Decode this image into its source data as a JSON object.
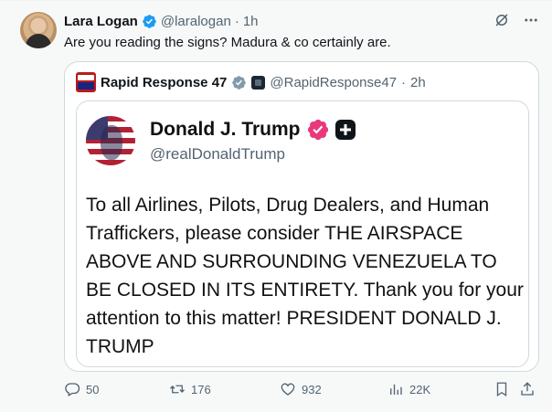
{
  "tweet": {
    "author_name": "Lara Logan",
    "author_handle": "@laralogan",
    "separator": "·",
    "time": "1h",
    "text": "Are you reading the signs? Madura & co certainly are."
  },
  "quote": {
    "author_name": "Rapid Response 47",
    "author_handle": "@RapidResponse47",
    "separator": "·",
    "time": "2h"
  },
  "truth_post": {
    "author_name": "Donald J. Trump",
    "author_handle": "@realDonaldTrump",
    "text": "To all Airlines, Pilots, Drug Dealers, and Human Traffickers, please consider THE AIRSPACE ABOVE AND SURROUNDING VENEZUELA TO BE CLOSED IN ITS ENTIRETY. Thank you for your attention to this matter! PRESIDENT DONALD J. TRUMP"
  },
  "actions": {
    "replies": "50",
    "reposts": "176",
    "likes": "932",
    "views": "22K"
  },
  "icons": [
    "verified-badge-icon",
    "grok-icon",
    "more-icon",
    "gray-verified-badge-icon",
    "affiliate-badge-icon",
    "pink-verified-badge-icon",
    "truth-plus-icon",
    "reply-icon",
    "repost-icon",
    "like-icon",
    "views-icon",
    "bookmark-icon",
    "share-icon"
  ],
  "colors": {
    "x_blue": "#1d9bf0",
    "muted_text": "#536471",
    "border": "#cfd9de",
    "truth_pink": "#e8397b"
  }
}
